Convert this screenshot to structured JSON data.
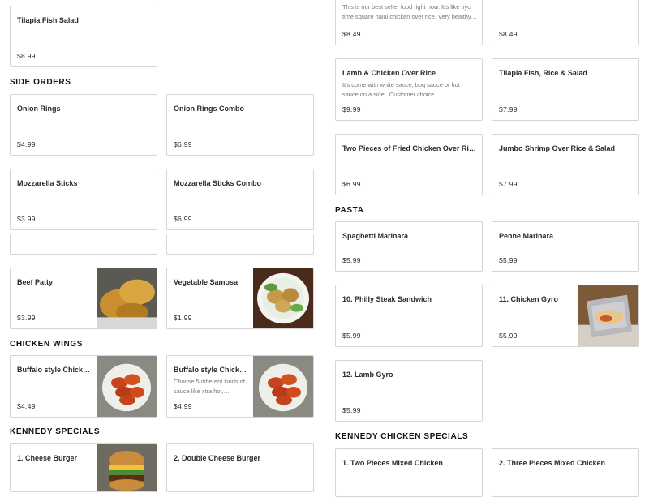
{
  "sections": {
    "side_orders": "SIDE ORDERS",
    "chicken_wings": "CHICKEN WINGS",
    "kennedy_specials": "KENNEDY SPECIALS",
    "pasta": "PASTA",
    "kennedy_chicken_specials": "KENNEDY CHICKEN SPECIALS"
  },
  "items": {
    "tilapia_fish_salad": {
      "title": "Tilapia Fish Salad",
      "price": "$8.99"
    },
    "top_right_1": {
      "desc": "This is our best seller food right now. It's like nyc time square halal chicken over rice. Very healthy…",
      "price": "$8.49"
    },
    "top_right_2": {
      "price": "$8.49"
    },
    "onion_rings": {
      "title": "Onion Rings",
      "price": "$4.99"
    },
    "onion_rings_combo": {
      "title": "Onion Rings Combo",
      "price": "$6.99"
    },
    "mozzarella_sticks": {
      "title": "Mozzarella Sticks",
      "price": "$3.99"
    },
    "mozzarella_sticks_combo": {
      "title": "Mozzarella Sticks Combo",
      "price": "$6.99"
    },
    "beef_patty": {
      "title": "Beef Patty",
      "price": "$3.99"
    },
    "vegetable_samosa": {
      "title": "Vegetable Samosa",
      "price": "$1.99"
    },
    "buffalo_1": {
      "title": "Buffalo style Chicken…",
      "price": "$4.49"
    },
    "buffalo_2": {
      "title": "Buffalo style Chicken…",
      "desc": "Choose 5 different kinds of sauce like xtra hot,…",
      "price": "$4.99"
    },
    "cheese_burger": {
      "title": "1. Cheese Burger"
    },
    "double_cheese_burger": {
      "title": "2. Double Cheese Burger"
    },
    "lamb_chicken_rice": {
      "title": "Lamb & Chicken Over Rice",
      "desc": "It's come with white sauce, bbq sauce or hot sauce on a side . Customer choice",
      "price": "$9.99"
    },
    "tilapia_rice_salad": {
      "title": "Tilapia Fish, Rice & Salad",
      "price": "$7.99"
    },
    "fried_chicken_rice": {
      "title": "Two Pieces of Fried Chicken Over Rice &…",
      "price": "$6.99"
    },
    "jumbo_shrimp": {
      "title": "Jumbo Shrimp Over Rice & Salad",
      "price": "$7.99"
    },
    "spaghetti_marinara": {
      "title": "Spaghetti Marinara",
      "price": "$5.99"
    },
    "penne_marinara": {
      "title": "Penne Marinara",
      "price": "$5.99"
    },
    "philly_steak": {
      "title": "10. Philly Steak Sandwich",
      "price": "$5.99"
    },
    "chicken_gyro": {
      "title": "11. Chicken Gyro",
      "price": "$5.99"
    },
    "lamb_gyro": {
      "title": "12. Lamb Gyro",
      "price": "$5.99"
    },
    "two_pieces_mixed": {
      "title": "1. Two Pieces Mixed Chicken"
    },
    "three_pieces_mixed": {
      "title": "2. Three Pieces Mixed Chicken"
    }
  },
  "icons": {
    "beef_patty": "beef-patty-photo",
    "samosa": "samosa-photo",
    "wings": "buffalo-wings-photo",
    "burger": "burger-photo",
    "gyro": "gyro-photo"
  },
  "colors": {
    "border": "#d5d5d5",
    "muted_text": "#777777"
  }
}
